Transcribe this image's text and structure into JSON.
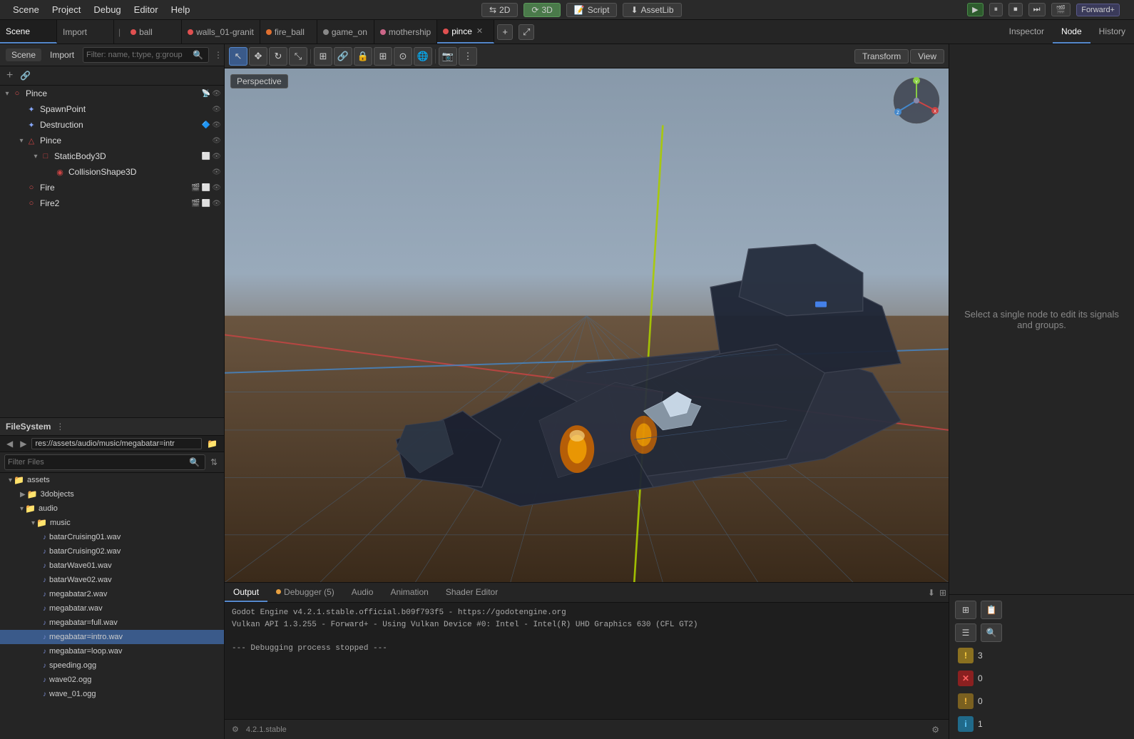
{
  "menu": {
    "items": [
      "Scene",
      "Project",
      "Debug",
      "Editor",
      "Help"
    ]
  },
  "toolbar": {
    "mode2d": "2D",
    "mode3d": "3D",
    "script": "Script",
    "assetlib": "AssetLib",
    "play_btn": "▶",
    "pause_btn": "⏸",
    "stop_btn": "⏹",
    "forward_label": "Forward+"
  },
  "tabs": [
    {
      "label": "ball",
      "color": "#e05050",
      "active": false,
      "closable": false
    },
    {
      "label": "walls_01-granit",
      "color": "#e05050",
      "active": false,
      "closable": false
    },
    {
      "label": "fire_ball",
      "color": "#e07030",
      "active": false,
      "closable": false
    },
    {
      "label": "game_on",
      "color": "#888888",
      "active": false,
      "closable": false
    },
    {
      "label": "mothership",
      "color": "#cc6688",
      "active": false,
      "closable": false
    },
    {
      "label": "pince",
      "color": "#e05050",
      "active": true,
      "closable": true
    }
  ],
  "inspector_tabs": [
    "Inspector",
    "Node",
    "History"
  ],
  "scene_panel": {
    "title": "Scene",
    "import_tab": "Import",
    "filter_placeholder": "Filter: name, t:type, g:group",
    "tree": [
      {
        "level": 0,
        "icon": "○",
        "icon_color": "#e05050",
        "label": "Pince",
        "icons_right": [
          "📡",
          "👁"
        ],
        "arrow": "▾",
        "expanded": true
      },
      {
        "level": 1,
        "icon": "✦",
        "icon_color": "#88aaff",
        "label": "SpawnPoint",
        "icons_right": [
          "👁"
        ]
      },
      {
        "level": 1,
        "icon": "✦",
        "icon_color": "#88aaff",
        "label": "Destruction",
        "icons_right": [
          "🔷",
          "👁"
        ],
        "has_badge": true,
        "badge_color": "#5588cc"
      },
      {
        "level": 1,
        "icon": "△",
        "icon_color": "#cc4444",
        "label": "Pince",
        "icons_right": [
          "👁"
        ],
        "arrow": "▾",
        "expanded": true
      },
      {
        "level": 2,
        "icon": "□",
        "icon_color": "#cc4444",
        "label": "StaticBody3D",
        "icons_right": [
          "⬜",
          "👁"
        ],
        "arrow": "▾",
        "expanded": true
      },
      {
        "level": 3,
        "icon": "◉",
        "icon_color": "#cc4444",
        "label": "CollisionShape3D",
        "icons_right": [
          "👁"
        ]
      },
      {
        "level": 1,
        "icon": "○",
        "icon_color": "#e05050",
        "label": "Fire",
        "icons_right": [
          "🎬",
          "⬜",
          "👁"
        ]
      },
      {
        "level": 1,
        "icon": "○",
        "icon_color": "#e05050",
        "label": "Fire2",
        "icons_right": [
          "🎬",
          "⬜",
          "👁"
        ]
      }
    ]
  },
  "filesystem": {
    "title": "FileSystem",
    "path": "res://assets/audio/music/megabatar=intr",
    "filter_placeholder": "Filter Files",
    "tree": [
      {
        "level": 0,
        "type": "folder",
        "label": "assets",
        "expanded": true,
        "arrow": "▾"
      },
      {
        "level": 1,
        "type": "folder",
        "label": "3dobjects",
        "expanded": false,
        "arrow": "▶"
      },
      {
        "level": 1,
        "type": "folder",
        "label": "audio",
        "expanded": true,
        "arrow": "▾"
      },
      {
        "level": 2,
        "type": "folder",
        "label": "music",
        "expanded": true,
        "arrow": "▾"
      },
      {
        "level": 3,
        "type": "audio",
        "label": "batarCruising01.wav"
      },
      {
        "level": 3,
        "type": "audio",
        "label": "batarCruising02.wav"
      },
      {
        "level": 3,
        "type": "audio",
        "label": "batarWave01.wav"
      },
      {
        "level": 3,
        "type": "audio",
        "label": "batarWave02.wav"
      },
      {
        "level": 3,
        "type": "audio",
        "label": "megabatar2.wav"
      },
      {
        "level": 3,
        "type": "audio",
        "label": "megabatar.wav"
      },
      {
        "level": 3,
        "type": "audio",
        "label": "megabatar=full.wav"
      },
      {
        "level": 3,
        "type": "audio",
        "label": "megabatar=intro.wav",
        "selected": true
      },
      {
        "level": 3,
        "type": "audio",
        "label": "megabatar=loop.wav"
      },
      {
        "level": 3,
        "type": "audio",
        "label": "speeding.ogg"
      },
      {
        "level": 3,
        "type": "audio",
        "label": "wave02.ogg"
      },
      {
        "level": 3,
        "type": "audio",
        "label": "wave_01.ogg"
      }
    ]
  },
  "viewport": {
    "perspective_label": "Perspective"
  },
  "viewport_toolbar": {
    "select": "↖",
    "move": "✥",
    "rotate": "↻",
    "scale": "⤡",
    "transform": "Transform",
    "view": "View"
  },
  "output": {
    "tabs": [
      "Output",
      "Debugger (5)",
      "Audio",
      "Animation",
      "Shader Editor"
    ],
    "lines": [
      "Godot Engine v4.2.1.stable.official.b09f793f5 - https://godotengine.org",
      "Vulkan API 1.3.255 - Forward+ - Using Vulkan Device #0: Intel - Intel(R) UHD Graphics 630 (CFL GT2)",
      "",
      "--- Debugging process stopped ---"
    ],
    "version": "4.2.1.stable"
  },
  "inspector": {
    "tabs": [
      "Inspector",
      "Node",
      "History"
    ],
    "empty_text": "Select a single node to edit its signals\nand groups.",
    "badges": [
      {
        "type": "warn",
        "icon": "!",
        "count": "3"
      },
      {
        "type": "err",
        "icon": "✕",
        "count": "0"
      },
      {
        "type": "warn2",
        "icon": "!",
        "count": "0"
      },
      {
        "type": "info",
        "icon": "i",
        "count": "1"
      }
    ]
  }
}
